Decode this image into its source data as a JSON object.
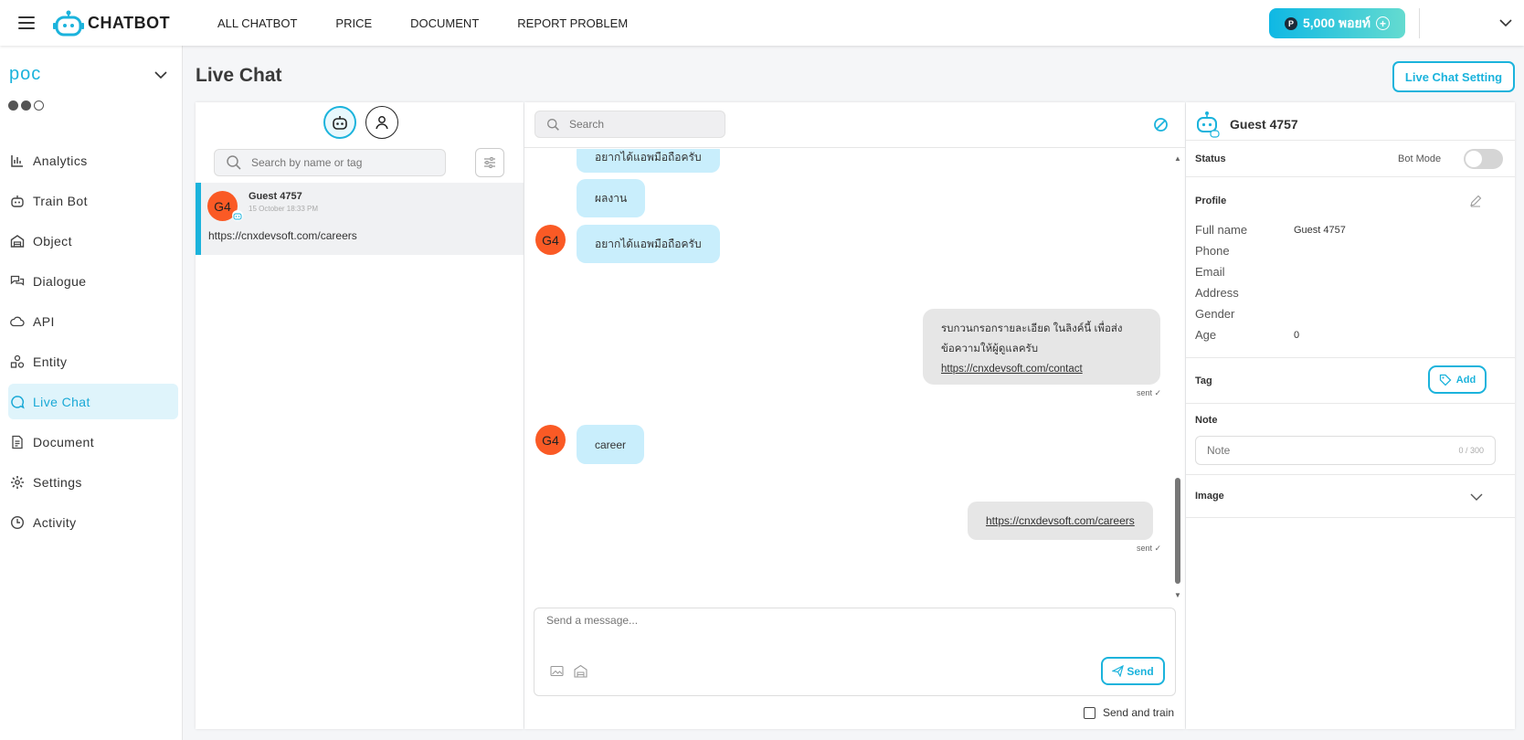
{
  "brand": {
    "logo_text": "CHATBOT"
  },
  "nav": {
    "items": [
      "ALL CHATBOT",
      "PRICE",
      "DOCUMENT",
      "REPORT PROBLEM"
    ]
  },
  "points": {
    "label": "5,000 พอยท์",
    "badge": "P"
  },
  "sidebar": {
    "bot_name": "poc",
    "menu": [
      {
        "label": "Analytics",
        "icon": "bar-chart-icon"
      },
      {
        "label": "Train Bot",
        "icon": "robot-icon"
      },
      {
        "label": "Object",
        "icon": "garage-icon"
      },
      {
        "label": "Dialogue",
        "icon": "chat-bubbles-icon"
      },
      {
        "label": "API",
        "icon": "cloud-icon"
      },
      {
        "label": "Entity",
        "icon": "shapes-icon"
      },
      {
        "label": "Live Chat",
        "icon": "chat-icon",
        "active": true
      },
      {
        "label": "Document",
        "icon": "document-icon"
      },
      {
        "label": "Settings",
        "icon": "gear-icon"
      },
      {
        "label": "Activity",
        "icon": "clock-icon"
      }
    ]
  },
  "page": {
    "title": "Live Chat",
    "setting_button": "Live Chat Setting"
  },
  "conversation_list": {
    "search_placeholder": "Search by name or tag",
    "items": [
      {
        "avatar": "G4",
        "name": "Guest 4757",
        "time": "15 October 18:33 PM",
        "last_message": "https://cnxdevsoft.com/careers"
      }
    ]
  },
  "chat": {
    "search_placeholder": "Search",
    "messages": [
      {
        "direction": "in",
        "text": "อยากได้แอพมือถือครับ"
      },
      {
        "direction": "in",
        "text": "ผลงาน"
      },
      {
        "direction": "in",
        "avatar": "G4",
        "text": "อยากได้แอพมือถือครับ"
      },
      {
        "direction": "out",
        "line1": "รบกวนกรอกรายละเอียด ในลิงค์นี้ เพื่อส่ง",
        "line2": "ข้อความให้ผู้ดูแลครับ",
        "link": "https://cnxdevsoft.com/contact",
        "status": "sent ✓"
      },
      {
        "direction": "in",
        "avatar": "G4",
        "text": "career"
      },
      {
        "direction": "out",
        "link": "https://cnxdevsoft.com/careers",
        "status": "sent ✓"
      }
    ],
    "composer_placeholder": "Send a message...",
    "send_label": "Send",
    "send_and_train_label": "Send and train"
  },
  "info": {
    "guest_name": "Guest 4757",
    "status_label": "Status",
    "bot_mode_label": "Bot Mode",
    "bot_mode_on": false,
    "profile_label": "Profile",
    "profile": [
      {
        "label": "Full name",
        "value": "Guest 4757"
      },
      {
        "label": "Phone",
        "value": ""
      },
      {
        "label": "Email",
        "value": ""
      },
      {
        "label": "Address",
        "value": ""
      },
      {
        "label": "Gender",
        "value": ""
      },
      {
        "label": "Age",
        "value": "0"
      }
    ],
    "tag_label": "Tag",
    "add_label": "Add",
    "note_label": "Note",
    "note_placeholder": "Note",
    "note_count": "0 / 300",
    "image_label": "Image"
  },
  "colors": {
    "accent": "#1bb3dc",
    "avatar": "#fa5a25",
    "incoming_bubble": "#c9eefc",
    "outgoing_bubble": "#e6e6e6"
  }
}
